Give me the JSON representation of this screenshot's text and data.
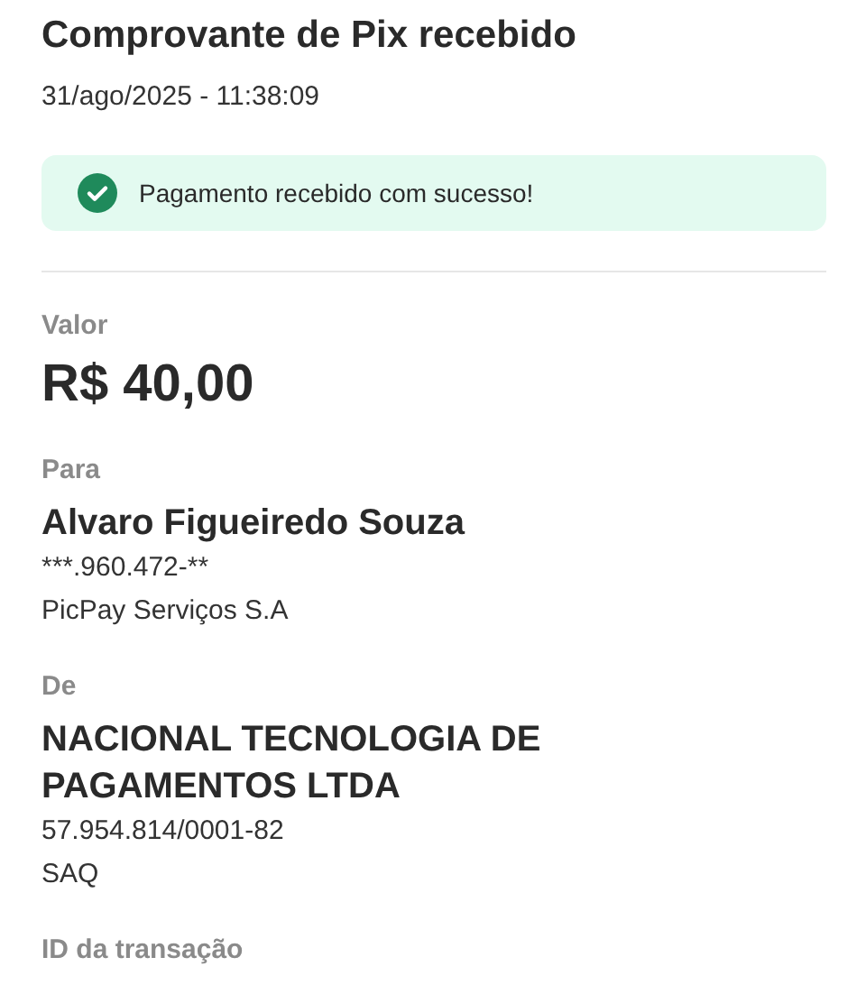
{
  "title": "Comprovante de Pix recebido",
  "datetime": "31/ago/2025 - 11:38:09",
  "banner": {
    "text": "Pagamento recebido com sucesso!",
    "success": true
  },
  "sections": [
    {
      "kind": "amount",
      "label": "Valor",
      "value": "R$ 40,00"
    },
    {
      "kind": "party",
      "label": "Para",
      "value": "Alvaro Figueiredo Souza",
      "details": [
        "***.960.472-**",
        "PicPay Serviços S.A"
      ]
    },
    {
      "kind": "party",
      "label": "De",
      "value": "NACIONAL TECNOLOGIA DE PAGAMENTOS LTDA",
      "details": [
        "57.954.814/0001-82",
        "SAQ"
      ]
    },
    {
      "kind": "label",
      "label": "ID da transação"
    }
  ]
}
